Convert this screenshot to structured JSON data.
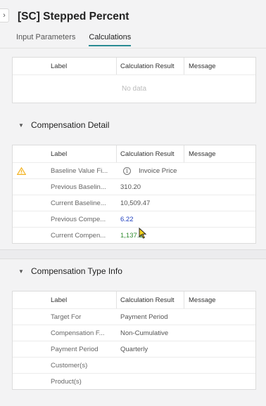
{
  "header": {
    "title": "[SC] Stepped Percent"
  },
  "tabs": [
    {
      "label": "Input Parameters"
    },
    {
      "label": "Calculations"
    }
  ],
  "columns": {
    "label": "Label",
    "result": "Calculation Result",
    "message": "Message"
  },
  "top_table": {
    "empty_text": "No data"
  },
  "compensation_detail": {
    "title": "Compensation Detail",
    "rows": [
      {
        "label": "Baseline Value Fi...",
        "result": "Invoice Price",
        "warning": true
      },
      {
        "label": "Previous Baselin...",
        "result": "310.20"
      },
      {
        "label": "Current Baseline...",
        "result": "10,509.47"
      },
      {
        "label": "Previous Compe...",
        "result": "6.22",
        "result_color": "#1f3fbf"
      },
      {
        "label": "Current Compen...",
        "result": "1,137.1",
        "result_color": "#2e8b2e"
      }
    ]
  },
  "compensation_type_info": {
    "title": "Compensation Type Info",
    "rows": [
      {
        "label": "Target For",
        "result": "Payment Period"
      },
      {
        "label": "Compensation F...",
        "result": "Non-Cumulative"
      },
      {
        "label": "Payment Period",
        "result": "Quarterly"
      },
      {
        "label": "Customer(s)",
        "result": ""
      },
      {
        "label": "Product(s)",
        "result": ""
      }
    ]
  },
  "icons": {
    "expander": "chevron-right-icon",
    "section_toggle": "chevron-down-icon",
    "warning": "warning-triangle-icon",
    "info": "info-circle-icon"
  },
  "colors": {
    "accent": "#2a8b93",
    "warning": "#f2b01e",
    "blue_value": "#1f3fbf",
    "green_value": "#2e8b2e"
  }
}
